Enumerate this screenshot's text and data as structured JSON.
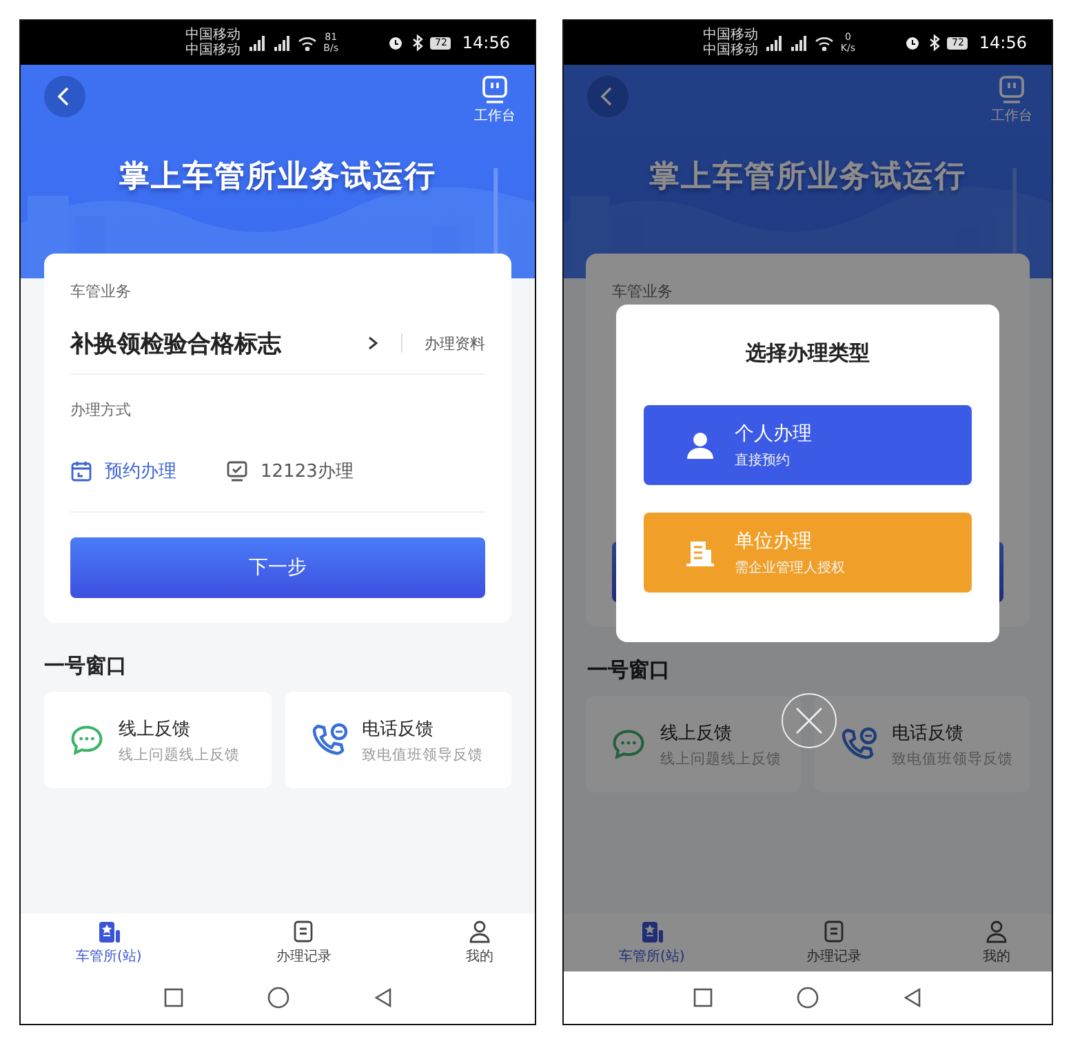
{
  "screens": [
    {
      "status_bar": {
        "carriers": [
          "中国移动",
          "中国移动"
        ],
        "speed_value": "81",
        "speed_unit": "B/s",
        "battery": "72",
        "time": "14:56"
      },
      "header": {
        "workbench_label": "工作台",
        "title": "掌上车管所业务试运行"
      },
      "business_card": {
        "label": "车管业务",
        "service": "补换领检验合格标志",
        "materials_link": "办理资料",
        "method_label": "办理方式",
        "methods": [
          {
            "kind": "appointment",
            "label": "预约办理",
            "selected": true
          },
          {
            "kind": "online",
            "label": "12123办理",
            "selected": false
          }
        ],
        "next_button": "下一步"
      },
      "section_title": "一号窗口",
      "feedback": [
        {
          "kind": "chat",
          "title": "线上反馈",
          "subtitle": "线上问题线上反馈"
        },
        {
          "kind": "phone",
          "title": "电话反馈",
          "subtitle": "致电值班领导反馈"
        }
      ],
      "tabs": [
        {
          "kind": "station",
          "label": "车管所(站)",
          "selected": true
        },
        {
          "kind": "records",
          "label": "办理记录",
          "selected": false
        },
        {
          "kind": "profile",
          "label": "我的",
          "selected": false
        }
      ]
    },
    {
      "status_bar": {
        "carriers": [
          "中国移动",
          "中国移动"
        ],
        "speed_value": "0",
        "speed_unit": "K/s",
        "battery": "72",
        "time": "14:56"
      },
      "header": {
        "workbench_label": "工作台",
        "title": "掌上车管所业务试运行"
      },
      "business_card": {
        "label": "车管业务"
      },
      "section_title": "一号窗口",
      "feedback": [
        {
          "kind": "chat",
          "title": "线上反馈",
          "subtitle": "线上问题线上反馈"
        },
        {
          "kind": "phone",
          "title": "电话反馈",
          "subtitle": "致电值班领导反馈"
        }
      ],
      "tabs": [
        {
          "kind": "station",
          "label": "车管所(站)",
          "selected": true
        },
        {
          "kind": "records",
          "label": "办理记录",
          "selected": false
        },
        {
          "kind": "profile",
          "label": "我的",
          "selected": false
        }
      ],
      "modal": {
        "title": "选择办理类型",
        "options": [
          {
            "kind": "person",
            "title": "个人办理",
            "subtitle": "直接预约",
            "color": "#3b5be6"
          },
          {
            "kind": "company",
            "title": "单位办理",
            "subtitle": "需企业管理人授权",
            "color": "#f0a028"
          }
        ]
      }
    }
  ]
}
